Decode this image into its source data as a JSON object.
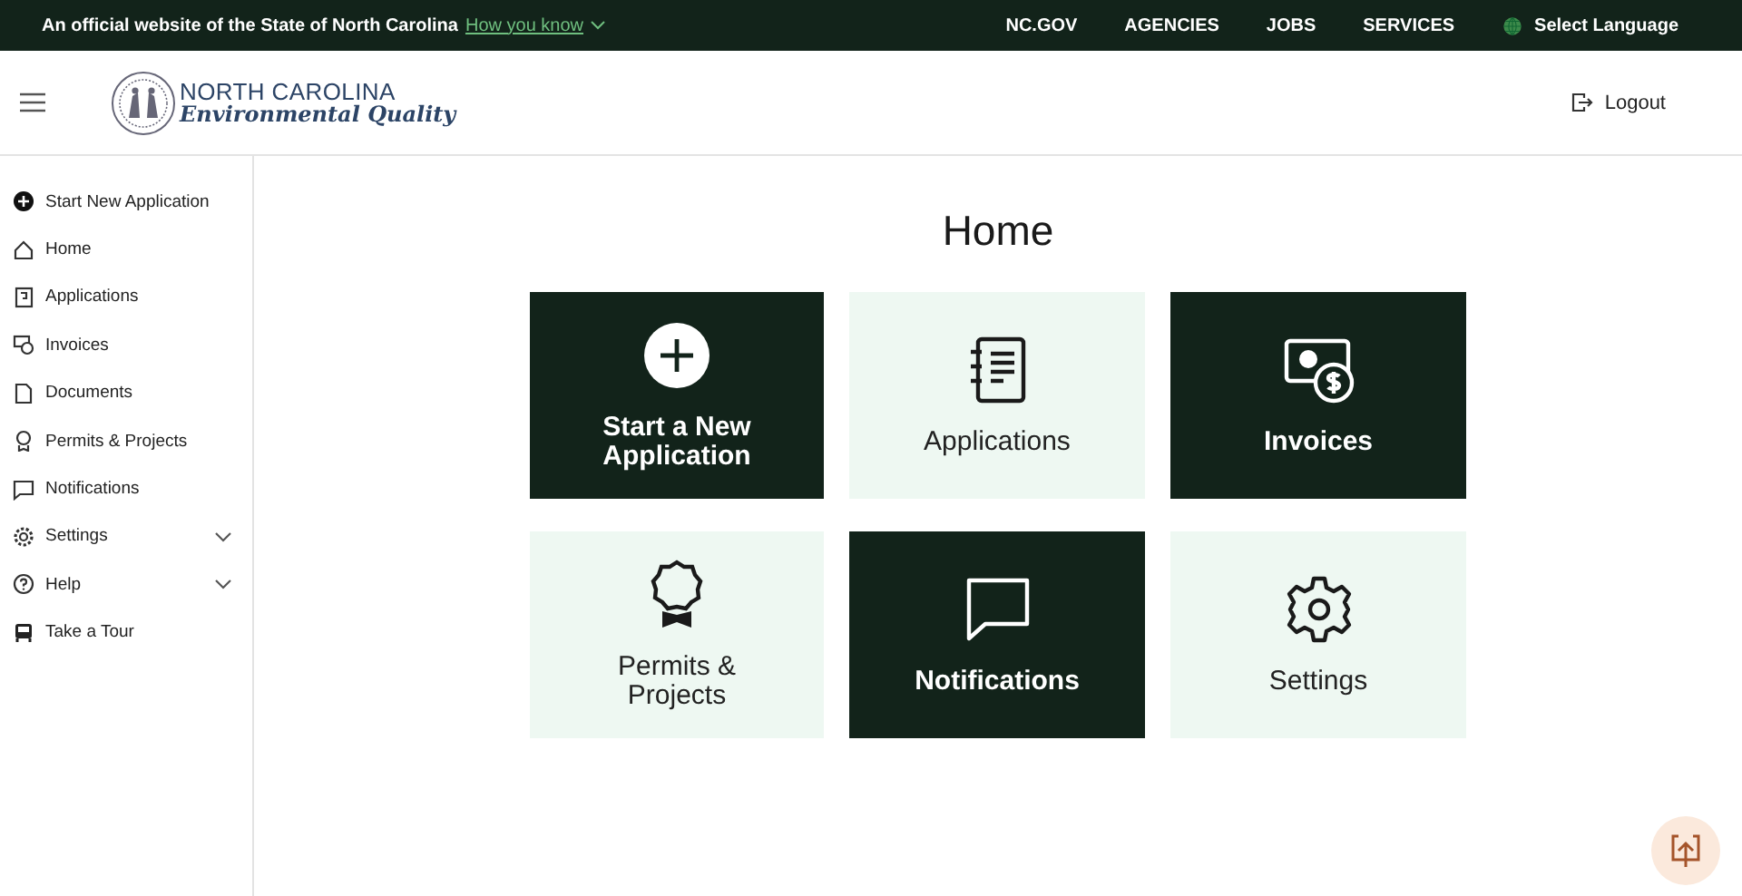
{
  "official_banner": {
    "text": "An official website of the State of North Carolina",
    "link": "How you know"
  },
  "top_nav": [
    "NC.GOV",
    "AGENCIES",
    "JOBS",
    "SERVICES"
  ],
  "language": "Select Language",
  "logo": {
    "line_1": "NORTH CAROLINA",
    "line_2": "Environmental Quality"
  },
  "logout": "Logout",
  "sidebar": {
    "items": [
      {
        "label": "Start New Application",
        "expandable": false
      },
      {
        "label": "Home",
        "expandable": false
      },
      {
        "label": "Applications",
        "expandable": false
      },
      {
        "label": "Invoices",
        "expandable": false
      },
      {
        "label": "Documents",
        "expandable": false
      },
      {
        "label": "Permits & Projects",
        "expandable": false
      },
      {
        "label": "Notifications",
        "expandable": false
      },
      {
        "label": "Settings",
        "expandable": true
      },
      {
        "label": "Help",
        "expandable": true
      },
      {
        "label": "Take a Tour",
        "expandable": false
      }
    ]
  },
  "page_title": "Home",
  "tiles": [
    {
      "label": "Start a New Application",
      "highlighted": true
    },
    {
      "label": "Applications",
      "highlighted": false
    },
    {
      "label": "Invoices",
      "highlighted": true
    },
    {
      "label": "Permits & Projects",
      "highlighted": false
    },
    {
      "label": "Notifications",
      "highlighted": true
    },
    {
      "label": "Settings",
      "highlighted": false
    }
  ]
}
